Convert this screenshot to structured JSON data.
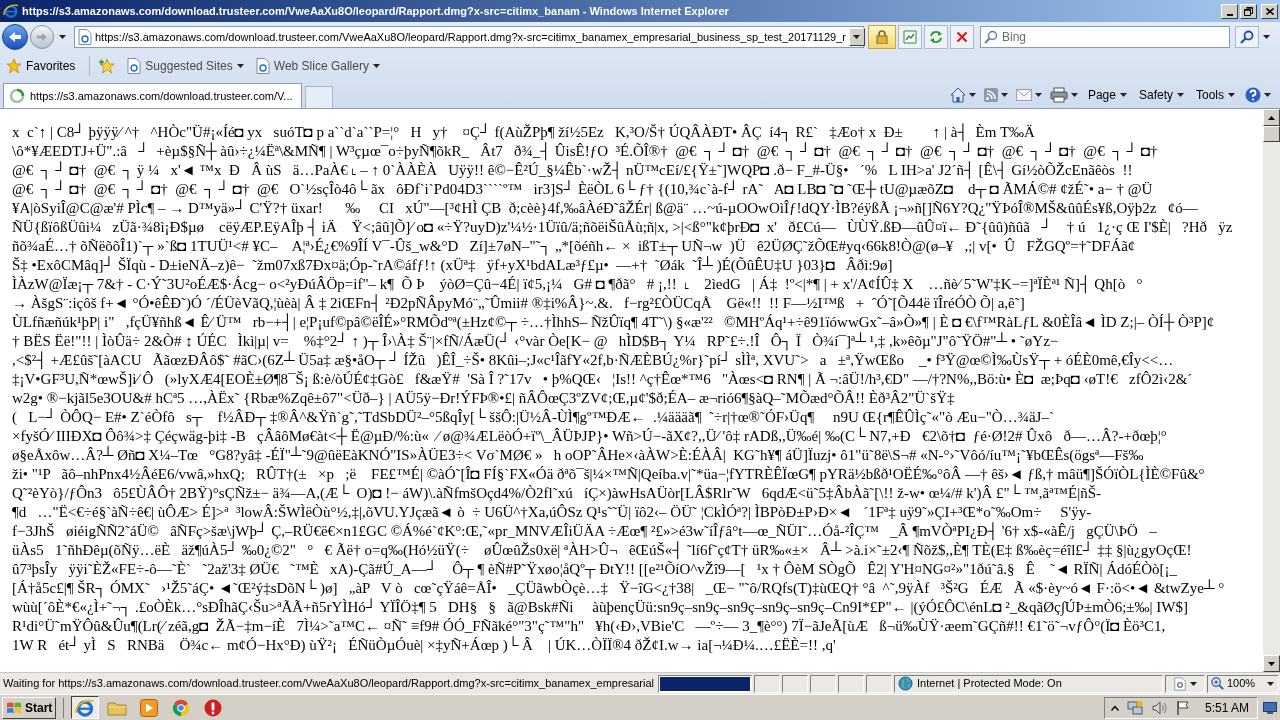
{
  "window": {
    "title": "https://s3.amazonaws.com/download.trusteer.com/VweAaXu8O/leopard/Rapport.dmg?x-src=citimx_banam - Windows Internet Explorer"
  },
  "address_bar": {
    "url": "https://s3.amazonaws.com/download.trusteer.com/VweAaXu8O/leopard/Rapport.dmg?x-src=citimx_banamex_empresarial_business_sp_test_20171129_r"
  },
  "search": {
    "placeholder": "Bing"
  },
  "favorites_bar": {
    "label": "Favorites",
    "links": [
      "Suggested Sites",
      "Web Slice Gallery"
    ]
  },
  "tabs": [
    {
      "label": "https://s3.amazonaws.com/download.trusteer.com/V...",
      "selected": true
    }
  ],
  "command_bar": {
    "menus": [
      "Page",
      "Safety",
      "Tools"
    ]
  },
  "page": {
    "lines": [
      "x  c`↑ | C8┘ þÿÿÿ⁄ ^†   ^HÒc\"Ü#¡«Íé◘ yx   suóT◘ p a``d`a``P=¦°   H   y†    ¤Ç┘ f(AùŽPþ¶ ží½5Ez   K,³O/Š† ÚQÂÀÐT• ÂÇ  í4┐ R£`   ‡Æo† x  Ð±        ↑ | à┤  Èm T‰Ä",
      "\\ô*¥ÆEDTJ+Ü\".:â   ┘  +èµ$§Ñ┼ àû›÷¿¼Ëª\\&MÑ¶ | W³çµœ¯o÷þyÑ¶õkR_   Ât7   ð¾_┤ ÛisÊ!ƒO  ³É.ÕÎ®†  @€  ┐ ┘ ◘†  @€  ┐ ┘ ◘†  @€  ┐ ┘ ◘†  @€  ┐ ┘ ◘†  @€  ┐ ┘ ◘†  @€  ┐ ┘ ◘†",
      "@€  ┐ ┘ ◘†  @€  ┐ ÿ ¼   x'◄ ™x  Ð   Â ùS   ä…PaÀ€ ˪ – ↑ 0`ÀÀÈÀ   Uÿÿ!! ê©−Ê²Ú_§¼Êb`·wŽ┤ nÜ™cEí/£{Ÿ±˜]WQP◘ .ð− F_#-Ü§•   ´%   L IH>a' J2´ñ┤ [Ê\\┤ Gí½òÕŽcEnãêòs  !!",
      "@€  ┐ ┘ ◘†  @€  ┐ ┘ ◘†  @€  ┐ ┘ ◘†  @€   O`½sçÎò4ô└ ãx   ôÐf`i`Pd04D3````º™   ir3]S┘ ÈëÒL 6└ ƒ† {(10,¾c`à-f┘ rA˜   A◘ LB◘ ˜◘ ˜Œ┼ tU@µæõZ◘    d┬ ◘ ÃMÁ©# ¢žÉ˜• a− † @Ü",
      "¥A|òSyiÎ@C@æ'# PÌc¶ – → D™yä»┘ C'Ÿ?† üxar!      ‰     CI   xÚ\"—[³¢HÌ ÇB  ð;cèè}4f,‰âÀéÐ˜âŽÉr| ß@ä¨ …~ú-µOOwOìÎƒ!dQY·ÌB?éÿßÃ ¡¬»ñ[]Ñ6Y?Q¿\"ŸÞóÎ®MŠ&ûûÉs¥ß,Oÿþ2z   ¢ó—",
      "ÑÜ{ßïôßÜûi¼   zÜã·¾8ì¡Ð$µø    cëÿÆP.EÿAÎþ ┤ iÄ    Ÿ<;âû]Õ]⁄ o◘ «÷Ÿ?uyD)z'¼½·1Üïû/ä;ñõëiŠûÅù;ñ|x, >|<ß°\"k¢þrÐ◘  x'   ð£Cú—   ÙÙŸ.ßÐ—ûÛ¤ï← Ð˜{ûû)ñûã   ┘    † ú   1¿·ç Œ I'$È|   ?Hð   ÿz",
      "ñõ¾aÉ…† õÑëõõÎ1)`┬ »`ß◘ 1TUÜ¹<# ¥C–    A¦ª›É¿€%9ÎÍ V¯-Ûš_w&°D   Zí]±7øN–\"˜┐ „*[õéñh← ×  ißT±┬ UÑ¬w  )Ü   ê2ÜØÇ˜žÕŒ#yq‹66k8!Ò@(ø–¥   ,;| v[•  Û   FŽGQº=†˜DFÁã¢",
      "Š‡ •ExôCMâq]┘ ŠÏqù - D±ieNÄ–z)ê−  ˜žm07xß7Ðx¤ä;Óp-˜rA©áfƒ!↑ (xÜª‡   ÿf+yX¹bdALæ³ƒ£µ•  —+†  ˜Øák  ˜Î┴ )É(ÕûÊU‡U }03}◘   Âðì:9ø]",
      "ÌÀzW@Ïæ¡┬ 7&† - C·Ý˜3U²oÉÆ$·Ácg− o<²yÐúÂÖp=if\"– k¶  Õ Þ    ýòØ=Çû−4É| ï¢5,¡¼   G# ◘ ¶ðã°   # ¡,!!  ˪    2ìedG   | Á‡  !º<|*¶ | + x'/A¢ÍÛ‡ X    …ñè⁄ 5˜W'‡K−=]ªÏÈª¹ Ñ]┤ Qh[ò   °",
      "→ ÀšgS¨:içôš f+◄ °Ó•êÊÐ˜)Ó ´/ÉÜèVãQ,¦ùèà| Â ‡ 2iŒFn┤ ²Ð2pÑÂpyMó¨„˜Ûmii# ®‡i%Â}~.&.   f−rg²£ÒÜCqÅ    Gë«!!  !! F—½I™ß   +  ˆÓ˜[Õ44ë ïÎréÓÒ Õ| a,ê˜]",
      "ÙLfñæñúk¹þP| i\"   ,fçÜ¥ñhß◄ Ê⁄ Ü™   rb−+┤| e¦P¡uf©pâ©ëÎÉ»°RMÕdºª(±Hz¢©┬ ÷…†ÌhhS– ÑžÛïq¶ 4T˜\\) §«æ'²²   ©MHºÁq¹+÷ê91ïówwGx˜–â»Ò»¶ | È ◘ €\\f™RàLƒL &0ÈÎâ◄ ÌD Z;|– ÒÍ┼ Ò³P]¢",
      "† BËS Ëë!\"!! | ÌòÛä÷ 2&Ò# ↕ ÚÉC   Ìkì|µ| v=    %‡°2┘ ↑ )┬ Î›\\À‡ Š¨|×fÑ/ÁæÜ(┘ ‹°vàr Òe[K− @   hÌD$B┐ Y¼   RP˜£÷.!Î   Ô┐ Ï   Ò¾í¯]ª┴ ¹,‡ ,k»êõµ\"J\"ô˜ŸÖ#\"┴ • ˜øYz−",
      ",<$²┤ +Æ£ûš˜[àACU   ÃãœzÐÂô$˜ #ãC›(6Z┴ Ü5a‡ æ§•åO┬ ┘ ÍŽû   )ÊÎ_÷Š• 8Kûi–;J«c¹ÎãfY«2f,b·ÑÆÈBÚ¿%r}˜pí┘ sÌÌª, XVU˜>   a   ±ª,ŸwŒßo    _• f³Ÿ@œ©Ì‰ÙsŸ┬ + óÉÈ0mê,€Îy<<…",
      "‡¡V•GF³U,Ñ*œwŠ]i⁄ Ô   (»lyXÆ4[EOÈ±Ø¶8¯Š¡ ß:è/òÚÉ¢‡Gò£   f&æŸ#  'Sà Î ?˜17v   • þ%QŒ‹   ¦Is!! ^ç†Êœ*™6   \"Àœs<◘ RN¶ | Ã ¬:âÜ!/h³,€D\" —/†?N%,,Bö:ù• È◘  æ;Þq◘ ‹øT!€   zfÔ2ì‹2&´",
      "w2g• ®−kjãl5e3OU&# hCª5 …,ÀËx˜ {Rbæ%Zqê±ô7\"<Üð–} | AÜ5ÿ−Ðr!ÝFÞ®•£| ñÂÔœÇ3ºZV¢;Œ,µ¢'$ð;ÉA– æ¬rió6¶§àQ–˜MÕæd°ÕÂ!! Èð³Â2\"Ü`šŸ‡",
      "(   L−┘ ÒÔQ− E#• Z`éÒfô   s┬    f½ÂÐ┬ ‡®Â^&Ÿñ`g˜,˜TdSbDÜ²–°5ßqÎy[└ ššÔ:|Ü½Â-ÙÌ¶gº™ÐÆ←  .¼äääã¶  ˜÷r|†œ®˜ÓF›Üq¶     n9U Œ{r¶ÊÛÌç˜«\"ò Æu−\"Ò…¾äJ–`",
      "×fyšÓ⁄ IIIÐX◘ Ôô¾>‡ Çéçwäg-þi‡ -B   çÂâôMø€àt<┼ Ë@µÐ/%:ù«  ⁄ ø@¾ÆLëòÓ+ïº\\_ÂÜÞJP}• Wñ>Ú−-ãX¢?,,Ü⁄ 'ô‡ rADß,,Ü‰é| ‰(C└ N7,+Ð   €2\\õ†◘  ƒé·Ø!2# Ûxô   ð—…Â?-+ðœþ¦°",
      "ø§eÅxôw…Â?┴ Øñ◘ X¼–Tœ   °G8?yâ‡ -ÉÏ\"┴˜9@ûëEàKNÓ\"IS»ÀÜE3÷< Vσ`MØ€ »   h oOP˜ÂHe×‹àÀW>È:ÉÀÂ|  KG˜h¥¶ áÜ]Ïuzj• ô1\"ü˜8ë\\S¬# «N-°›˜Vôó/íu™¡˜¥bŒÊs(ögsª—Fš‰",
      "ži• \"¹P   ãô–nhPnx4½ÂéE6/vwâ,»hxQ;   RÛT†(±   ×p   ;ë    FE£™É| ©àÓ˜[Î◘ FÍ§`FX«Óä ðªõ¯š|¼×™Ñ|Qeíba.v|˜*üa−¦fYTRÈÊÏœG¶ pYRä½bßð¹OËÉ‰°ôÂ —† êš›◄ ƒß,† mâü¶]ŠÓïÒL{ÌÈ©Fû&°",
      "Q˜²èYò}/ƒÔn3   ô5£ÙÂÔ† 2BŸ)°sÇÑž±− ä¾—A,(Æ└  O)◘ !− áW)\\.àÑfmšOçd4%/Ò2fl˜xú   íÇ×)àwHsAÜòr[LÂ$Rlr˜W   6qdÆ<ü˜5‡ÂbÀã˜[\\!! ž-w• œ¼/# k')Â £\"└ ™,ãª™É|ñŠ-",
      "¶d   …\"Ë<€÷é§`àÑ÷ê€| ùÔÆ> É]>ª  ³lowÂ:ŠWÌëÒù°½,‡|,õVU.YJçæã◄ ò  ÷ U6Ü^†Xa,úÔSz Q¹s˜˜Ü| ïô2‹– ÖÜ˜ ¦CkÌÓª?| ÌBPòÐ±P›Ð×◄   ´1Fª‡ uÿ9˜»ÇI+³Œ*o˜‰Om÷     S'ÿy-",
      "f−3JhŠ   øiéigÑÑ2˜áÜ©   âÑFç>šæ\\jWþ┘ Ç,–RÜ€ë€×n1£GC ©Á%é`¢K°:Œ,˜«pr_MNVÆÎiÜÄA ÷Æœ¶ ²£»>é3w˜íÎƒâ°t—œ_ÑÜI˜…Óå-²ÎÇ™   _Â ¶mVÒªPI¿Ð┤ '6† x$-«àÊ/j   gÇÜ\\ÞÖ   –",
      "üÀs5   1˜ñhÐêµ(õÑÿ…ëÈ   äž¶úÀ5┘ ‰0¿©2\"   °   € Ãë† o=q‰(Hó½üŸ(÷    øÛœûŽs0xë| ªÀH>Û¬   êŒúŠ«┤ ˜lí6f˜ç¢T† üR‰«±×   Â┴ >à.i×˜±2‹¶ Ñõž$,,È¶ TÈ(E‡ ß‰èç=éîl£┘ ‡‡ §|ù¿gyOçŒ!",
      "û7³þsÎy   ÿÿi˜ÈŽ«FE÷-ô—˜È`   ˜2až'3‡ ØÜ€   ˜™È   xA)-Çã#Ú_A—┘    Ô┬ ¶ èÑ#P˜Ÿxøo¦åQº┬ ÐtY!! [[e²¹ÕíO^vŽî9—[   ¹x † ÔèM SÒgÕ   Ê2| Y'H¤NG¤²»\"1ðú˜â.§   Ê    ˜◄ RÏÑ| ÁdóÉÒò[¡_",
      "[Á†å5c£|¶ ŠR┐ ÓMX˜   ›¹Ž5˜áÇ• ◄˜Œ²ý‡sDõN└ )ø]   „àP   V ò   cœ˜çŸáê=ÅÎ•   _ÇÜãwbÒçè…‡   Ÿ−îG<¿†38|   _Œ− \"˜ô/RQfs(T)‡ùŒQ† °â  ^˜,9ÿÀf   ³Š²G   ÉÆ   Ã «$·èy~ó◄ F·:ö<•◄ &twZye┴ °",
      "wùù[´ôÈ*€«¿Ì+˜¬┐ .£oÒÈk…°sÐÎhãÇ‹Šu>ªÃÃ+ñ5rYÌHó┘ YÏÎÖ‡¶ 5   DH§   §   ã@Bsk#Ñi     àùþençÜü:sn9ç–sn9ç–sn9ç–sn9ç–sn9ç–Cn9I*£P\"← |(ýÓ£ÔC\\énL◘ ²_&qãØç∫ÚÞ±mÒ6;±‰| IW$]",
      "R¹di°Ü˜mŸÔû&Ûu¶(Lr(⁄ zéã,g◘  ŽÃ−‡m−íÈ   7Ì¼>˜a™C← ¤Ñ˜ ≡f9# ÓÓ_FÑãké°\"3\"ç˜™\"h\"   ¥h(‹Ð›,VBie'C   —º÷— 3_¶è°°) 7Ï−ãJeÃ[ùÆ   ß¬ü‰ÙŸ·æem˜GÇñ#!! €1˜ö˜¬vƒÔ°(Ï◘ Èö³C1,",
      "1W R   ét┘ yÌ   S   RNBä    Ö¾c← m¢Ó−Hx°Ð) ùŸ²¡   ÉÑüÒµÓuè| ×‡yÑ+Áœp )└ Â    | ÚK…ÒÏÏ®4 ðŽ¢I.w→ ia[¬¼Ð¼.…£ËÈ=!! ,q'"
    ]
  },
  "status_bar": {
    "text": "Waiting for https://s3.amazonaws.com/download.trusteer.com/VweAaXu8O/leopard/Rapport.dmg?x-src=citimx_banamex_empresarial",
    "progress": {
      "level": 1
    },
    "zone": "Internet | Protected Mode: On",
    "zoom": "100%"
  },
  "taskbar": {
    "start": "Start",
    "apps": [
      {
        "kind": "browser",
        "selected": true
      },
      {
        "kind": "folder",
        "selected": false
      },
      {
        "kind": "player",
        "selected": false
      },
      {
        "kind": "ring",
        "selected": false
      },
      {
        "kind": "alert",
        "selected": false
      }
    ],
    "clock": "5:51 AM"
  }
}
